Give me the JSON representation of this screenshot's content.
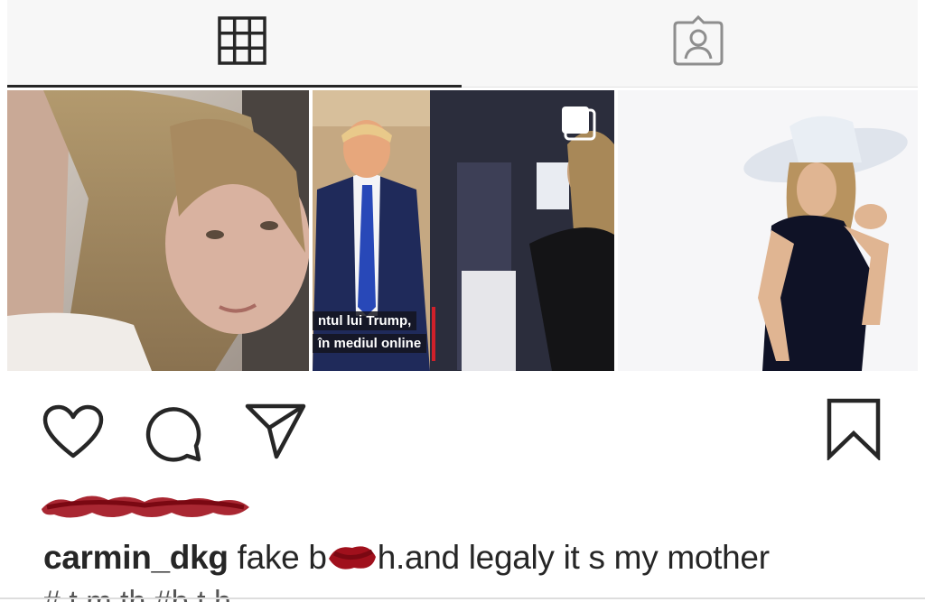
{
  "tabs": {
    "grid_icon": "grid-icon",
    "tagged_icon": "tagged-user-icon",
    "active": "grid"
  },
  "grid": {
    "post2_subtitle_line1": "ntul lui Trump,",
    "post2_subtitle_line2": "în mediul online",
    "post2_multi_icon": "multiple-posts-icon"
  },
  "actions": {
    "like_icon": "heart-icon",
    "comment_icon": "comment-icon",
    "share_icon": "paper-plane-icon",
    "save_icon": "bookmark-icon"
  },
  "caption": {
    "username": "carmin_dkg",
    "text_before": " fake b",
    "text_after": "h.and legaly it s my mother",
    "hashtags": "#     t     m     th     #b   t  h"
  },
  "colors": {
    "redaction": "#a0101c",
    "text": "#262626"
  }
}
